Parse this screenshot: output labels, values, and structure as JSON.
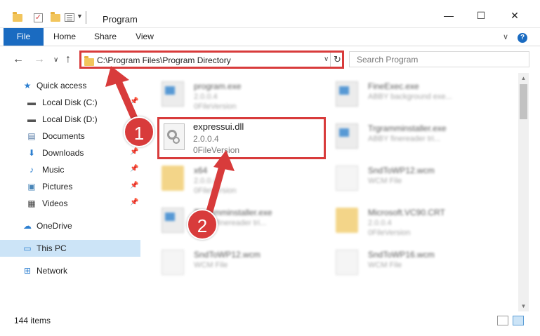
{
  "window": {
    "title": "Program",
    "minimize": "—",
    "maximize": "☐",
    "close": "✕"
  },
  "ribbon": {
    "tabs": [
      "File",
      "Home",
      "Share",
      "View"
    ],
    "expand": "∨",
    "help": "?"
  },
  "nav": {
    "back": "←",
    "forward": "→",
    "recent": "∨",
    "up": "↑",
    "address": "C:\\Program Files\\Program Directory",
    "refresh": "↻",
    "search_placeholder": "Search Program"
  },
  "sidebar": {
    "items": [
      {
        "label": "Quick access",
        "icon": "star-icon"
      },
      {
        "label": "Local Disk (C:)",
        "icon": "drive-icon"
      },
      {
        "label": "Local Disk (D:)",
        "icon": "drive-icon"
      },
      {
        "label": "Documents",
        "icon": "documents-icon"
      },
      {
        "label": "Downloads",
        "icon": "download-icon"
      },
      {
        "label": "Music",
        "icon": "music-icon"
      },
      {
        "label": "Pictures",
        "icon": "pictures-icon"
      },
      {
        "label": "Videos",
        "icon": "video-icon"
      },
      {
        "label": "OneDrive",
        "icon": "cloud-icon"
      },
      {
        "label": "This PC",
        "icon": "computer-icon"
      },
      {
        "label": "Network",
        "icon": "network-icon"
      }
    ]
  },
  "files": {
    "items": [
      {
        "name": "program.exe",
        "line1": "2.0.0.4",
        "line2": "0FileVersion"
      },
      {
        "name": "FineExec.exe",
        "line1": "ABBY background exe...",
        "line2": ""
      },
      {
        "name": "Trgramminstaller.exe",
        "line1": "ABBY finereader tri...",
        "line2": ""
      },
      {
        "name": "x64",
        "line1": "2.0.0.4",
        "line2": "0FileVersion"
      },
      {
        "name": "SndToWP12.wcm",
        "line1": "WCM File",
        "line2": ""
      },
      {
        "name": "Trgramminstaller.exe",
        "line1": "ABBY finereader tri...",
        "line2": ""
      },
      {
        "name": "Microsoft.VC90.CRT",
        "line1": "2.0.0.4",
        "line2": "0FileVersion"
      },
      {
        "name": "SndToWP12.wcm",
        "line1": "WCM File",
        "line2": ""
      },
      {
        "name": "SndToWP16.wcm",
        "line1": "WCM File",
        "line2": ""
      }
    ],
    "highlighted": {
      "name": "expressui.dll",
      "line1": "2.0.0.4",
      "line2": "0FileVersion"
    }
  },
  "status": {
    "count": "144 items"
  },
  "annotations": {
    "step1": "1",
    "step2": "2",
    "color": "#d83b3b"
  }
}
